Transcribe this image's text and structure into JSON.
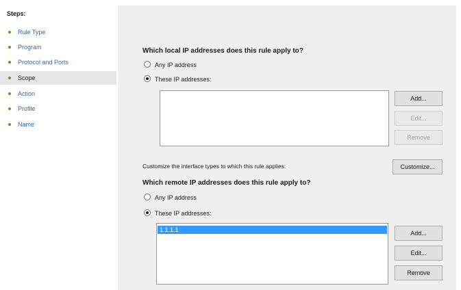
{
  "sidebar": {
    "title": "Steps:",
    "items": [
      {
        "label": "Rule Type",
        "active": false
      },
      {
        "label": "Program",
        "active": false
      },
      {
        "label": "Protocol and Ports",
        "active": false
      },
      {
        "label": "Scope",
        "active": true
      },
      {
        "label": "Action",
        "active": false
      },
      {
        "label": "Profile",
        "active": false
      },
      {
        "label": "Name",
        "active": false
      }
    ]
  },
  "local": {
    "question": "Which local IP addresses does this rule apply to?",
    "any_label": "Any IP address",
    "these_label": "These IP addresses:",
    "selected": "these",
    "addresses": [],
    "add_label": "Add...",
    "edit_label": "Edit...",
    "remove_label": "Remove"
  },
  "customize": {
    "text": "Customize the interface types to which this rule applies:",
    "button_label": "Customize..."
  },
  "remote": {
    "question": "Which remote IP addresses does this rule apply to?",
    "any_label": "Any IP address",
    "these_label": "These IP addresses:",
    "selected": "these",
    "addresses": [
      "1.1.1.1"
    ],
    "add_label": "Add...",
    "edit_label": "Edit...",
    "remove_label": "Remove"
  }
}
